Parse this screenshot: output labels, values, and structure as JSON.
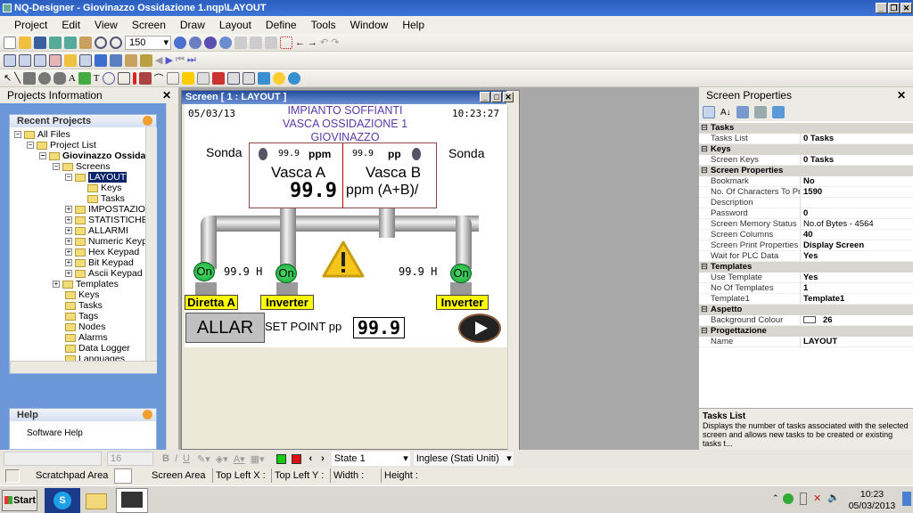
{
  "window": {
    "title": "NQ-Designer - Giovinazzo Ossidazione 1.nqp\\LAYOUT"
  },
  "menu": [
    "Project",
    "Edit",
    "View",
    "Screen",
    "Draw",
    "Layout",
    "Define",
    "Tools",
    "Window",
    "Help"
  ],
  "toolbar": {
    "zoom": "150"
  },
  "left_panel": {
    "title": "Projects Information",
    "recent_title": "Recent Projects",
    "tree": [
      "All Files",
      "Project List",
      "Giovinazzo Ossidaz",
      "Screens",
      "LAYOUT",
      "Keys",
      "Tasks",
      "IMPOSTAZIONI",
      "STATISTICHE",
      "ALLARMI",
      "Numeric Keypad",
      "Hex Keypad",
      "Bit Keypad",
      "Ascii Keypad",
      "Templates",
      "Keys",
      "Tasks",
      "Tags",
      "Nodes",
      "Alarms",
      "Data Logger",
      "Languages"
    ],
    "help_title": "Help",
    "help_item": "Software Help"
  },
  "screen_window": {
    "title": "Screen  [ 1 : LAYOUT ]"
  },
  "hmi": {
    "date": "05/03/13",
    "time": "10:23:27",
    "title": [
      "IMPIANTO SOFFIANTI",
      "VASCA OSSIDAZIONE 1",
      "GIOVINAZZO"
    ],
    "sonda_left": "Sonda",
    "sonda_right": "Sonda",
    "a_small": "99.9",
    "a_unit": "ppm",
    "a_label": "Vasca A",
    "a_value": "99.9",
    "b_small": "99.9",
    "b_unit": "pp",
    "b_label": "Vasca B",
    "b_unit2": "ppm (A+B)/",
    "on": "On",
    "h1": "99.9 H",
    "h2": "99.9 H",
    "label1": "Diretta A",
    "label2": "Inverter",
    "label3": "Inverter",
    "alarm_btn": "ALLAR",
    "setpoint_label": "SET POINT pp",
    "setpoint_value": "99.9"
  },
  "right_panel": {
    "title": "Screen Properties",
    "sections": [
      {
        "name": "Tasks",
        "rows": [
          [
            "Tasks List",
            "0 Tasks"
          ]
        ]
      },
      {
        "name": "Keys",
        "rows": [
          [
            "Screen Keys",
            "0  Tasks"
          ]
        ]
      },
      {
        "name": "Screen Properties",
        "rows": [
          [
            "Bookmark",
            "No"
          ],
          [
            "No. Of Characters To Print",
            "1590"
          ],
          [
            "Description",
            ""
          ],
          [
            "Password",
            "0"
          ],
          [
            "Screen Memory Status",
            "No.of Bytes - 4564"
          ],
          [
            "Screen Columns",
            "40"
          ],
          [
            "Screen Print Properties",
            "Display Screen"
          ],
          [
            "Wait for PLC Data",
            "Yes"
          ]
        ]
      },
      {
        "name": "Templates",
        "rows": [
          [
            "Use Template",
            "Yes"
          ],
          [
            "No Of Templates",
            "1"
          ],
          [
            "Template1",
            "Template1"
          ]
        ]
      },
      {
        "name": "Aspetto",
        "rows": [
          [
            "Background Colour",
            "26"
          ]
        ]
      },
      {
        "name": "Progettazione",
        "rows": [
          [
            "Name",
            "LAYOUT"
          ]
        ]
      }
    ],
    "desc_title": "Tasks List",
    "desc_text": "Displays the number of tasks associated with the selected screen and allows new tasks to be created or existing tasks t..."
  },
  "format_bar": {
    "font_size": "16",
    "state": "State 1",
    "language": "Inglese (Stati Uniti)"
  },
  "status": {
    "scratchpad": "Scratchpad Area",
    "screen_area": "Screen Area",
    "top_left_x": "Top Left X :",
    "top_left_y": "Top Left Y :",
    "width": "Width :",
    "height": "Height :"
  },
  "taskbar": {
    "start": "Start",
    "time": "10:23",
    "date": "05/03/2013"
  },
  "colors": {
    "title_purple": "#5a3aa8",
    "on_green": "#22c04a",
    "label_yellow": "#ffff00"
  }
}
